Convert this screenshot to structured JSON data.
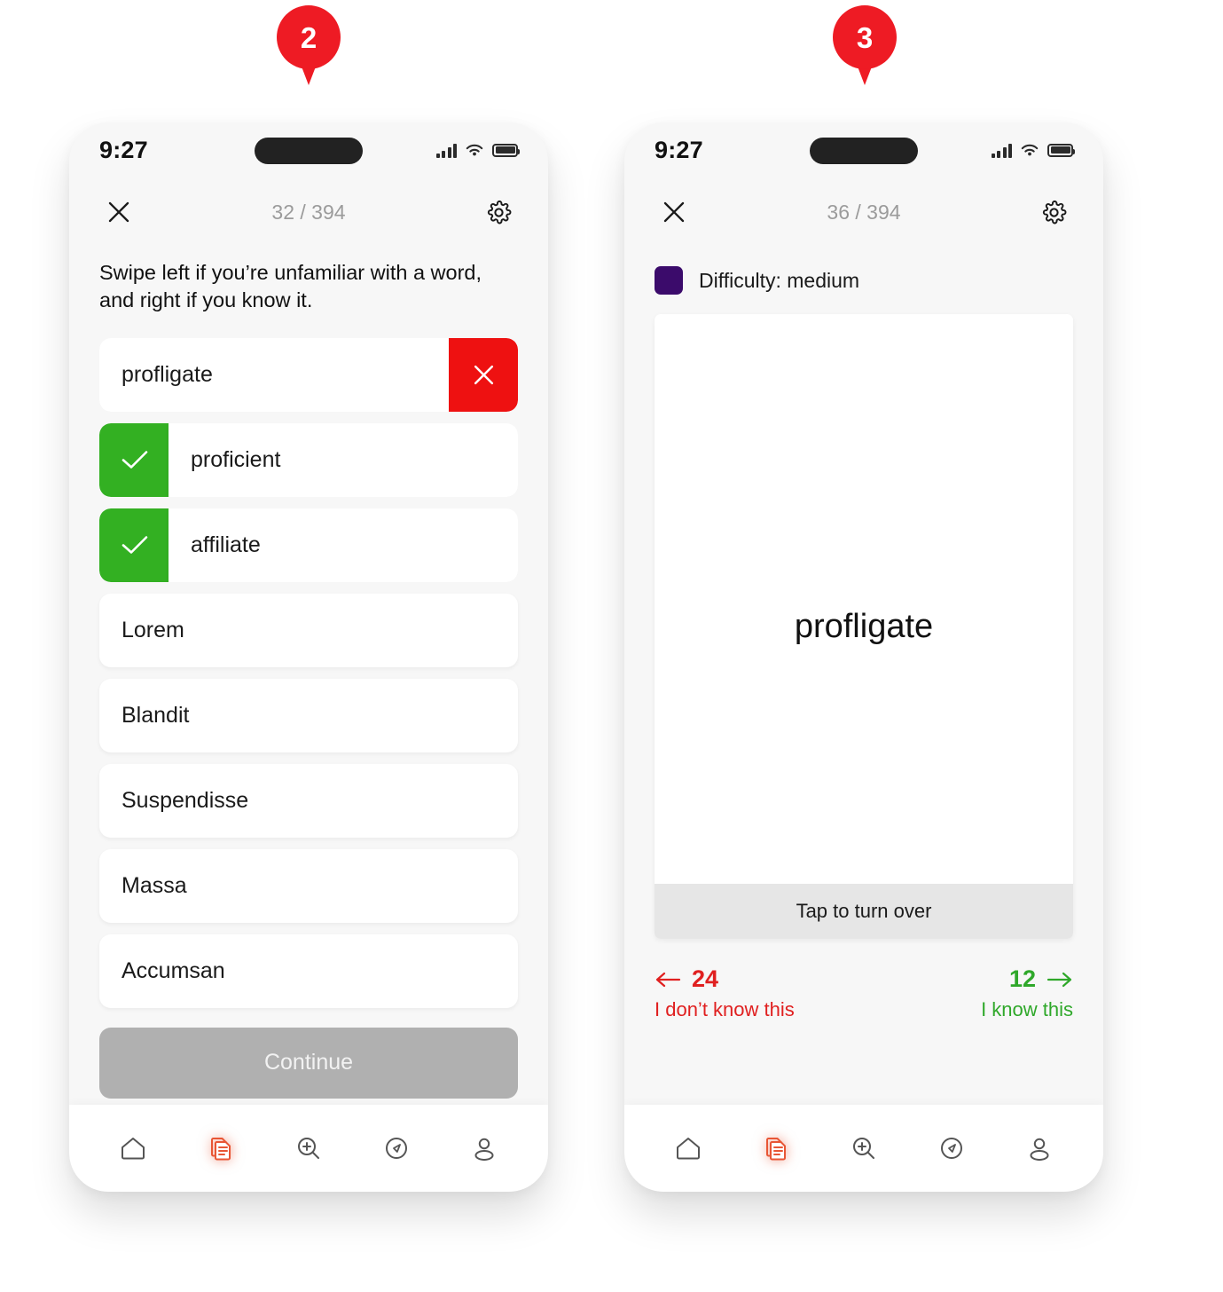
{
  "annotations": [
    {
      "number": "2",
      "name": "pin-2"
    },
    {
      "number": "3",
      "name": "pin-3"
    }
  ],
  "screen_left": {
    "status_bar": {
      "time": "9:27",
      "icons": [
        "cellular-signal-icon",
        "wifi-icon",
        "battery-icon"
      ]
    },
    "app_bar": {
      "close_icon": "close-icon",
      "counter": "32 / 394",
      "settings_icon": "gear-icon"
    },
    "instructions": "Swipe left if you’re unfamiliar with a word, and right if you know it.",
    "words": [
      {
        "label": "profligate",
        "state": "unknown",
        "action_icon": "close-icon"
      },
      {
        "label": "proficient",
        "state": "known",
        "action_icon": "check-icon"
      },
      {
        "label": "affiliate",
        "state": "known",
        "action_icon": "check-icon"
      },
      {
        "label": "Lorem",
        "state": "none",
        "action_icon": ""
      },
      {
        "label": "Blandit",
        "state": "none",
        "action_icon": ""
      },
      {
        "label": "Suspendisse",
        "state": "none",
        "action_icon": ""
      },
      {
        "label": "Massa",
        "state": "none",
        "action_icon": ""
      },
      {
        "label": "Accumsan",
        "state": "none",
        "action_icon": ""
      }
    ],
    "continue_label": "Continue"
  },
  "screen_right": {
    "status_bar": {
      "time": "9:27",
      "icons": [
        "cellular-signal-icon",
        "wifi-icon",
        "battery-icon"
      ]
    },
    "app_bar": {
      "close_icon": "close-icon",
      "counter": "36 / 394",
      "settings_icon": "gear-icon"
    },
    "difficulty": {
      "label": "Difficulty: medium",
      "color": "#3B0B6B"
    },
    "flashcard": {
      "word": "profligate",
      "footer": "Tap to turn over"
    },
    "counters": {
      "dont_know_count": "24",
      "dont_know_label": "I don’t know this",
      "know_count": "12",
      "know_label": "I know this"
    }
  },
  "bottom_nav": {
    "items": [
      {
        "icon": "home-icon",
        "active": false
      },
      {
        "icon": "documents-icon",
        "active": true
      },
      {
        "icon": "search-zoom-icon",
        "active": false
      },
      {
        "icon": "compass-icon",
        "active": false
      },
      {
        "icon": "profile-icon",
        "active": false
      }
    ]
  },
  "colors": {
    "accent_red": "#EE1111",
    "accent_green": "#33B022",
    "nav_active": "#E85635",
    "pin_red": "#EE1B24",
    "difficulty_purple": "#3B0B6B",
    "know_green": "#2FA82A",
    "dont_know_red": "#E02020"
  }
}
